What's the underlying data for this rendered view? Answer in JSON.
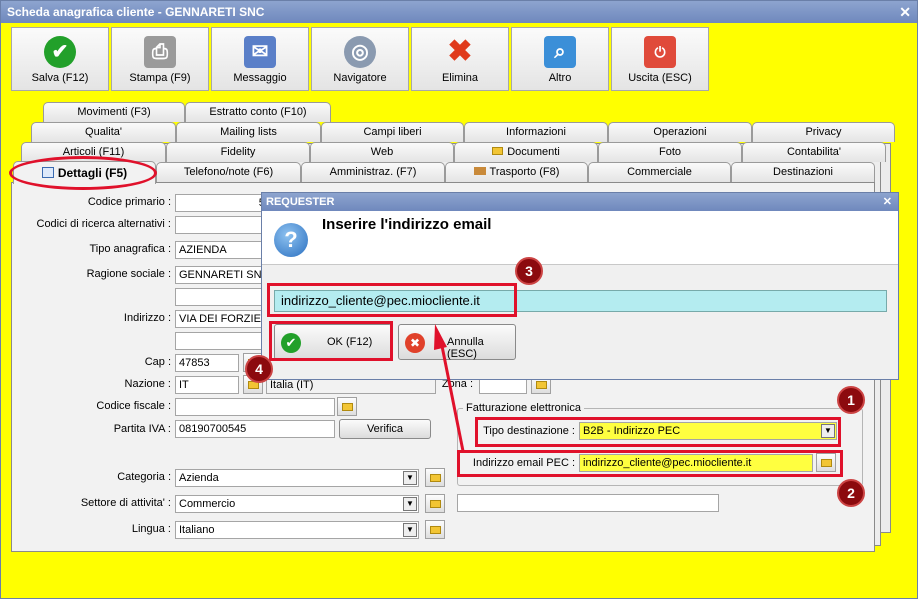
{
  "window": {
    "title": "Scheda anagrafica cliente - GENNARETI SNC",
    "close": "✕"
  },
  "toolbar": {
    "salva": "Salva (F12)",
    "stampa": "Stampa (F9)",
    "messaggio": "Messaggio",
    "navigatore": "Navigatore",
    "elimina": "Elimina",
    "altro": "Altro",
    "uscita": "Uscita (ESC)"
  },
  "tabs": {
    "movimenti": "Movimenti (F3)",
    "estratto": "Estratto conto (F10)",
    "qualita": "Qualita'",
    "mailing": "Mailing lists",
    "campi": "Campi liberi",
    "informazioni": "Informazioni",
    "operazioni": "Operazioni",
    "privacy": "Privacy",
    "articoli": "Articoli (F11)",
    "fidelity": "Fidelity",
    "web": "Web",
    "documenti": "Documenti",
    "foto": "Foto",
    "contabilita": "Contabilita'",
    "dettagli": "Dettagli (F5)",
    "telefono": "Telefono/note (F6)",
    "amministraz": "Amministraz. (F7)",
    "trasporto": "Trasporto (F8)",
    "commerciale": "Commerciale",
    "destinazioni": "Destinazioni"
  },
  "form": {
    "codice_primario": {
      "label": "Codice primario :",
      "value": "57"
    },
    "codici_alt": {
      "label": "Codici di ricerca alternativi :"
    },
    "tipo_anagrafica": {
      "label": "Tipo anagrafica :",
      "value": "AZIENDA"
    },
    "ragione_sociale": {
      "label": "Ragione sociale :",
      "value": "GENNARETI SNC"
    },
    "indirizzo": {
      "label": "Indirizzo :",
      "value": "VIA DEI FORZIER"
    },
    "cap": {
      "label": "Cap :",
      "value": "47853"
    },
    "nazione": {
      "label": "Nazione :",
      "value": "IT",
      "desc": "Italia (IT)"
    },
    "zona": {
      "label": "Zona :"
    },
    "codice_fiscale": {
      "label": "Codice fiscale :"
    },
    "partita_iva": {
      "label": "Partita IVA :",
      "value": "08190700545",
      "verifica": "Verifica"
    },
    "fatturazione": {
      "title": "Fatturazione elettronica",
      "tipo_label": "Tipo destinazione :",
      "tipo_value": "B2B - Indirizzo PEC",
      "pec_label": "Indirizzo email PEC :",
      "pec_value": "indirizzo_cliente@pec.miocliente.it"
    },
    "categoria": {
      "label": "Categoria :",
      "value": "Azienda"
    },
    "settore": {
      "label": "Settore di attivita' :",
      "value": "Commercio"
    },
    "lingua": {
      "label": "Lingua :",
      "value": "Italiano"
    }
  },
  "dialog": {
    "title": "REQUESTER",
    "close": "✕",
    "heading": "Inserire l'indirizzo email",
    "value": "indirizzo_cliente@pec.miocliente.it",
    "ok": "OK (F12)",
    "annulla": "Annulla (ESC)"
  },
  "badges": [
    "1",
    "2",
    "3",
    "4"
  ],
  "colors": {
    "background": "#ffff00",
    "highlight": "#e0112b",
    "badge": "#8c0a0e",
    "input_focus": "#b4ecf0"
  }
}
